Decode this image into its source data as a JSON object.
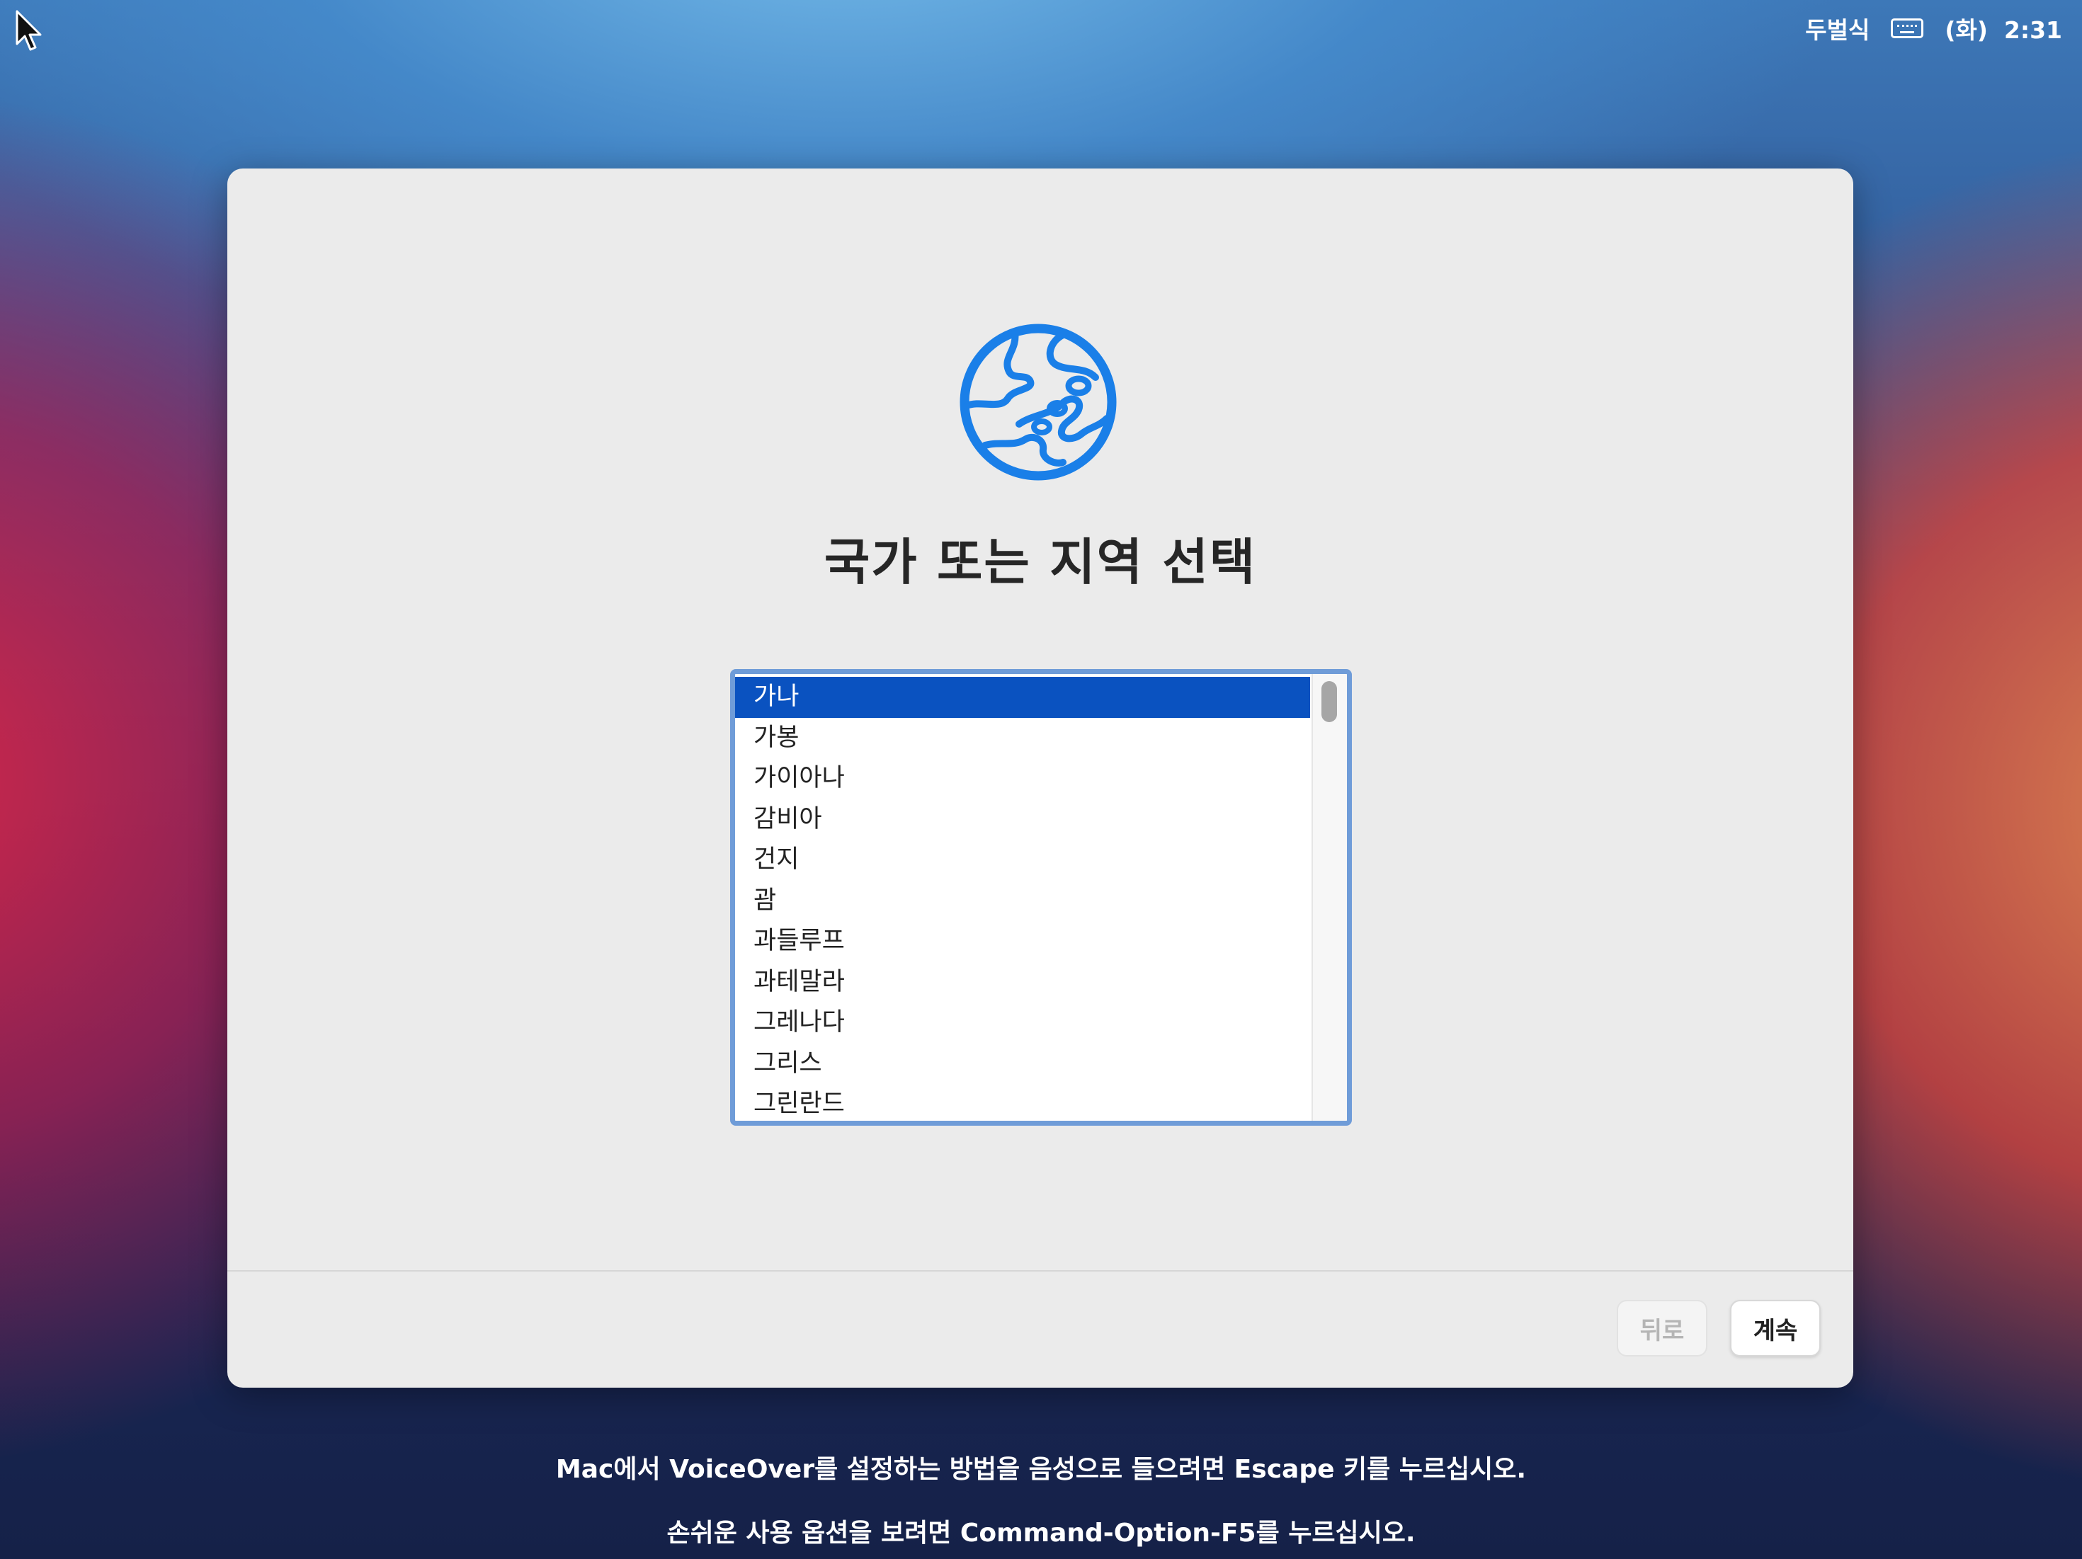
{
  "menubar": {
    "input_source": "두벌식",
    "day": "(화)",
    "time": "2:31"
  },
  "dialog": {
    "title": "국가 또는 지역 선택",
    "countries": [
      {
        "label": "가나",
        "selected": true
      },
      {
        "label": "가봉",
        "selected": false
      },
      {
        "label": "가이아나",
        "selected": false
      },
      {
        "label": "감비아",
        "selected": false
      },
      {
        "label": "건지",
        "selected": false
      },
      {
        "label": "괌",
        "selected": false
      },
      {
        "label": "과들루프",
        "selected": false
      },
      {
        "label": "과테말라",
        "selected": false
      },
      {
        "label": "그레나다",
        "selected": false
      },
      {
        "label": "그리스",
        "selected": false
      },
      {
        "label": "그린란드",
        "selected": false
      }
    ],
    "back_label": "뒤로",
    "continue_label": "계속"
  },
  "hints": {
    "voiceover": "Mac에서 VoiceOver를 설정하는 방법을 음성으로 들으려면 Escape 키를 누르십시오.",
    "accessibility": "손쉬운 사용 옵션을 보려면 Command-Option-F5를 누르십시오."
  },
  "colors": {
    "accent": "#0a52c0",
    "globe": "#1a7fe8",
    "list_border": "#6f9cd8"
  },
  "icons": {
    "globe": "globe-icon",
    "keyboard": "keyboard-icon",
    "cursor": "mouse-pointer-icon"
  }
}
